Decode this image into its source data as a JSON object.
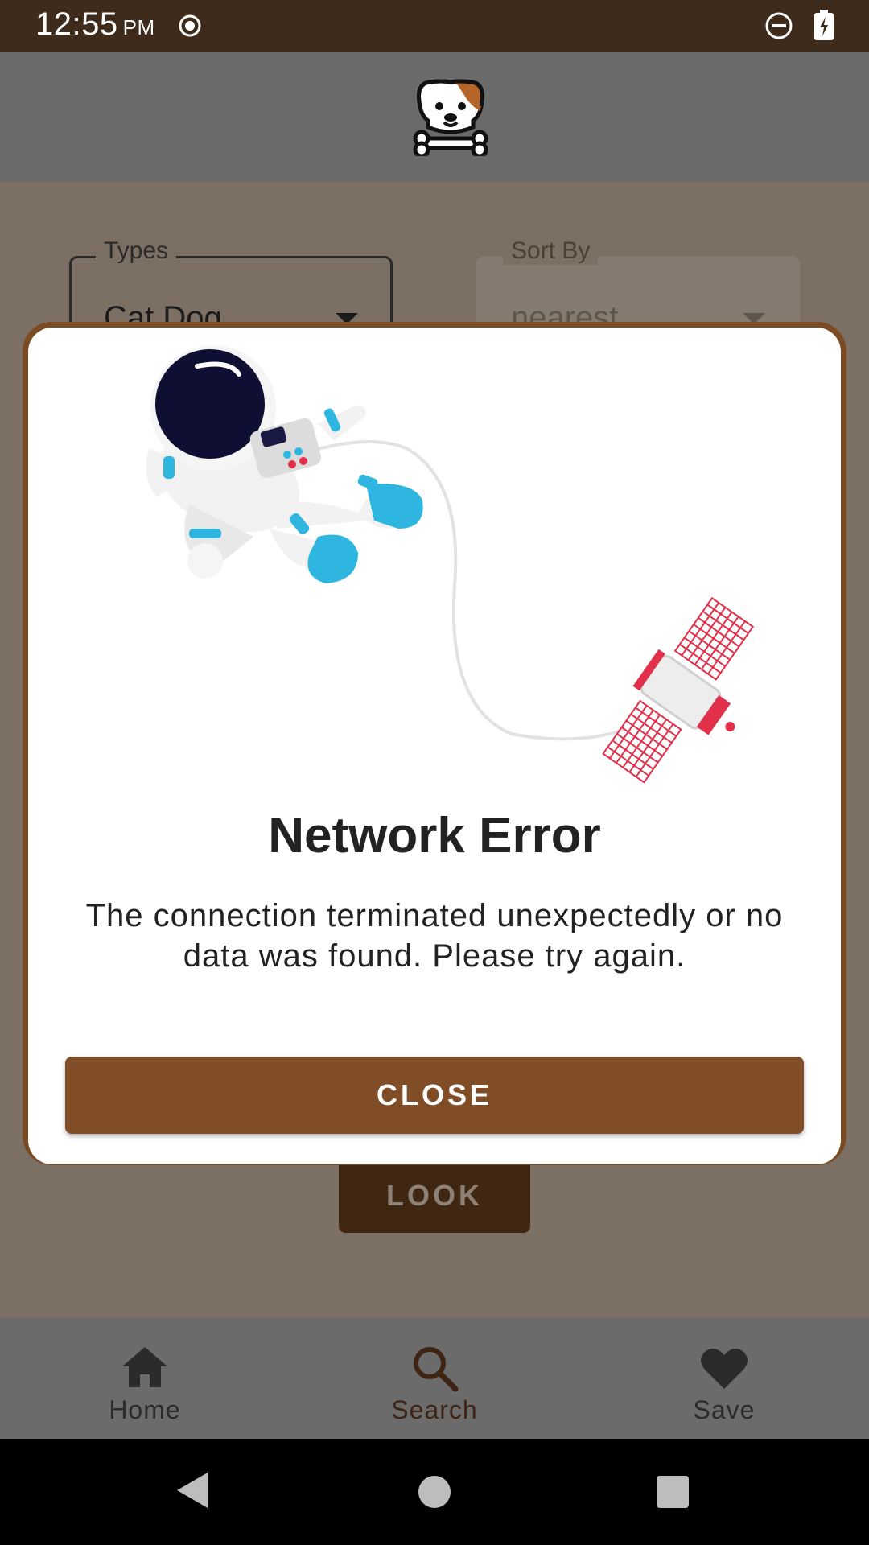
{
  "status_bar": {
    "time": "12:55",
    "ampm": "PM",
    "icons": [
      "record-icon",
      "do-not-disturb-icon",
      "battery-charging-icon"
    ]
  },
  "app_bar": {
    "logo_icon": "dog-logo-icon"
  },
  "filters": {
    "types": {
      "label": "Types",
      "value": "Cat,Dog"
    },
    "sort_by": {
      "label": "Sort By",
      "value": "nearest"
    }
  },
  "look_button": {
    "label": "LOOK"
  },
  "dialog": {
    "title": "Network Error",
    "message": "The connection terminated unexpectedly or no data was found. Please try again.",
    "close_label": "CLOSE",
    "illustration_icon": "astronaut-satellite-illustration"
  },
  "bottom_nav": {
    "items": [
      {
        "label": "Home",
        "icon": "home-icon"
      },
      {
        "label": "Search",
        "icon": "search-icon",
        "active": true
      },
      {
        "label": "Save",
        "icon": "heart-icon"
      }
    ]
  },
  "colors": {
    "status_bar": "#3e2b1b",
    "accent": "#804d27",
    "dialog_border": "#7b4b24",
    "scrim_bg": "#7c7064",
    "look_button": "#3f2712"
  }
}
